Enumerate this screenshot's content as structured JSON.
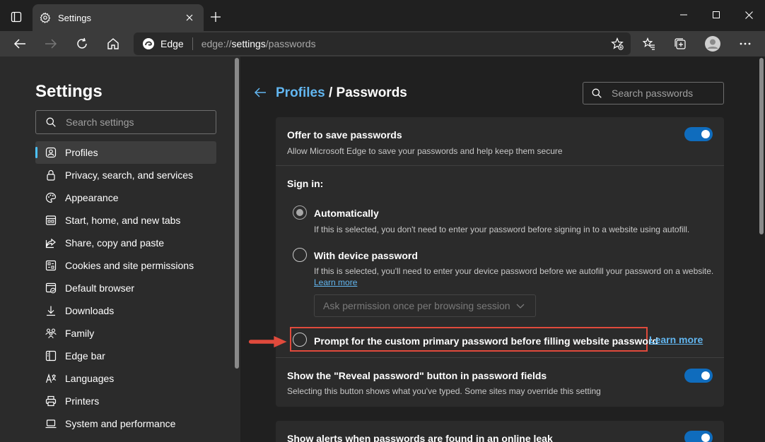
{
  "window": {
    "tab_title": "Settings",
    "controls": [
      "minimize",
      "maximize",
      "close"
    ]
  },
  "toolbar": {
    "brand": "Edge",
    "url_prefix": "edge://",
    "url_bold": "settings",
    "url_suffix": "/passwords"
  },
  "sidebar": {
    "title": "Settings",
    "search_placeholder": "Search settings",
    "items": [
      {
        "label": "Profiles",
        "icon": "profile-icon",
        "active": true
      },
      {
        "label": "Privacy, search, and services",
        "icon": "lock-icon"
      },
      {
        "label": "Appearance",
        "icon": "palette-icon"
      },
      {
        "label": "Start, home, and new tabs",
        "icon": "home-tabs-icon"
      },
      {
        "label": "Share, copy and paste",
        "icon": "share-icon"
      },
      {
        "label": "Cookies and site permissions",
        "icon": "cookie-icon"
      },
      {
        "label": "Default browser",
        "icon": "browser-icon"
      },
      {
        "label": "Downloads",
        "icon": "download-icon"
      },
      {
        "label": "Family",
        "icon": "family-icon"
      },
      {
        "label": "Edge bar",
        "icon": "edge-bar-icon"
      },
      {
        "label": "Languages",
        "icon": "language-icon"
      },
      {
        "label": "Printers",
        "icon": "printer-icon"
      },
      {
        "label": "System and performance",
        "icon": "laptop-icon"
      }
    ]
  },
  "main": {
    "breadcrumb_parent": "Profiles",
    "breadcrumb_sep": " / ",
    "breadcrumb_current": "Passwords",
    "search_placeholder": "Search passwords",
    "offer": {
      "title": "Offer to save passwords",
      "desc": "Allow Microsoft Edge to save your passwords and help keep them secure"
    },
    "signin": {
      "label": "Sign in:",
      "auto_title": "Automatically",
      "auto_desc": "If this is selected, you don't need to enter your password before signing in to a website using autofill.",
      "device_title": "With device password",
      "device_desc": "If this is selected, you'll need to enter your device password before we autofill your password on a website.",
      "device_learn": "Learn more",
      "select_value": "Ask permission once per browsing session",
      "custom_title": "Prompt for the custom primary password before filling website password",
      "custom_learn": "Learn more"
    },
    "reveal": {
      "title": "Show the \"Reveal password\" button in password fields",
      "desc": "Selecting this button shows what you've typed. Some sites may override this setting"
    },
    "leak": {
      "title": "Show alerts when passwords are found in an online leak"
    }
  }
}
